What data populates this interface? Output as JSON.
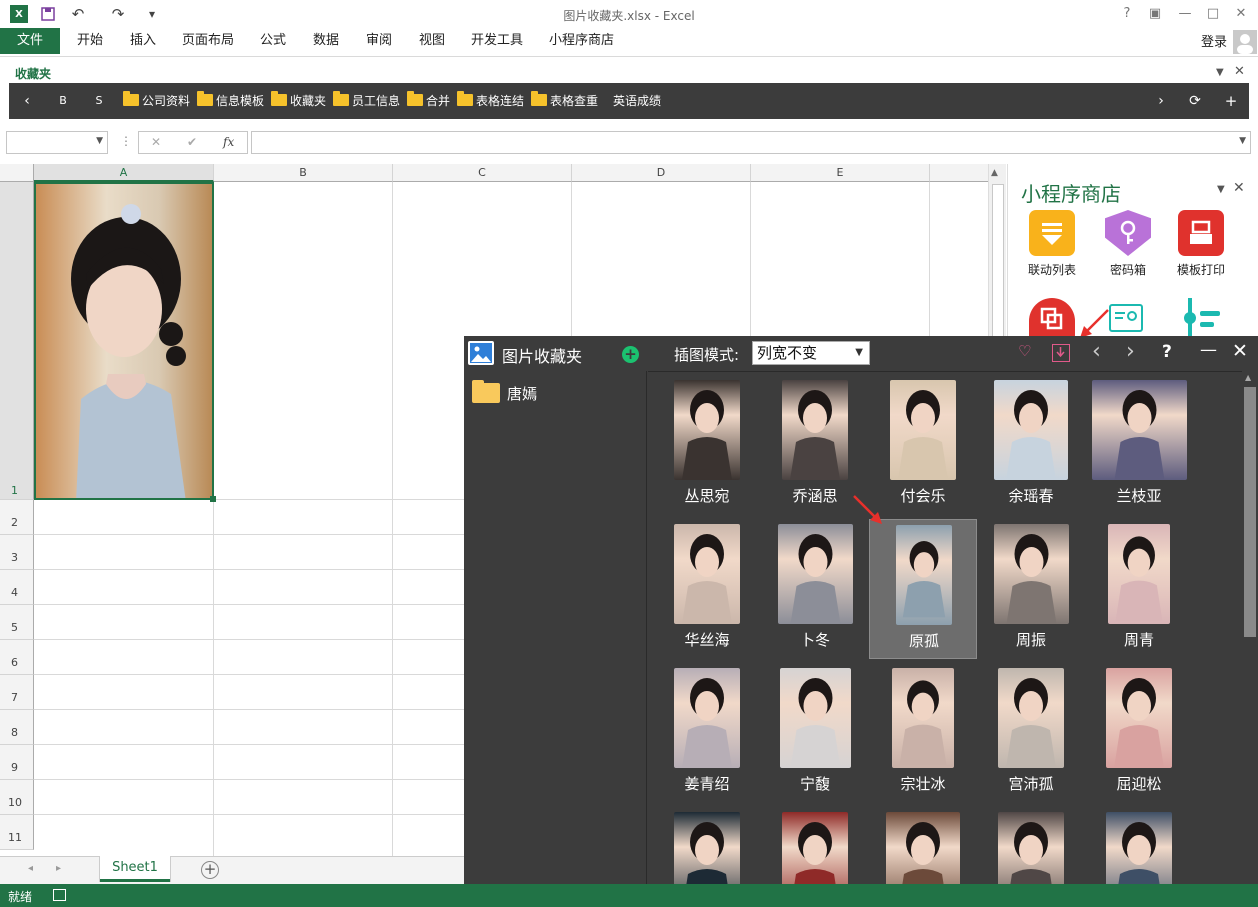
{
  "window": {
    "title": "图片收藏夹.xlsx - Excel"
  },
  "quick_access": {
    "undo": "↶",
    "redo": "↷",
    "customize": "▾"
  },
  "ribbon": {
    "file": "文件",
    "tabs": [
      "开始",
      "插入",
      "页面布局",
      "公式",
      "数据",
      "审阅",
      "视图",
      "开发工具",
      "小程序商店"
    ],
    "login": "登录"
  },
  "favorites": {
    "title": "收藏夹",
    "bold": "B",
    "strike": "S",
    "items": [
      "公司资料",
      "信息模板",
      "收藏夹",
      "员工信息",
      "合并",
      "表格连结",
      "表格查重"
    ],
    "last": "英语成绩"
  },
  "formula_bar": {
    "fx": "fx",
    "name_box": "",
    "formula": ""
  },
  "grid": {
    "columns": [
      "A",
      "B",
      "C",
      "D",
      "E"
    ],
    "rows": [
      "1",
      "2",
      "3",
      "4",
      "5",
      "6",
      "7",
      "8",
      "9",
      "10",
      "11"
    ]
  },
  "sheets": {
    "active": "Sheet1",
    "add": "+"
  },
  "status": {
    "ready": "就绪"
  },
  "store": {
    "title": "小程序商店",
    "apps": [
      {
        "label": "联动列表",
        "color": "#f9b21b"
      },
      {
        "label": "密码箱",
        "color": "#b972d8"
      },
      {
        "label": "模板打印",
        "color": "#e0322d"
      },
      {
        "label": "",
        "color": "#e0322d"
      },
      {
        "label": "",
        "color": "#1bb9b0"
      },
      {
        "label": "",
        "color": "#1bb9b0"
      }
    ]
  },
  "panel": {
    "title": "图片收藏夹",
    "mode_label": "插图模式:",
    "mode_value": "列宽不变",
    "folder": "唐嫣",
    "selected": "原孤",
    "thumbs": [
      {
        "name": "丛思宛",
        "color": "#3a3330"
      },
      {
        "name": "乔涵思",
        "color": "#4a4241"
      },
      {
        "name": "付会乐",
        "color": "#d8c6ae"
      },
      {
        "name": "余瑶春",
        "color": "#c7d3de"
      },
      {
        "name": "兰枝亚",
        "color": "#5d5c7e"
      },
      {
        "name": "华丝海",
        "color": "#cbb7ab"
      },
      {
        "name": "卜冬",
        "color": "#8c8e98"
      },
      {
        "name": "原孤",
        "color": "#8da0ae"
      },
      {
        "name": "周振",
        "color": "#7e7571"
      },
      {
        "name": "周青",
        "color": "#d9b5b7"
      },
      {
        "name": "姜青绍",
        "color": "#b7aeb6"
      },
      {
        "name": "宁馥",
        "color": "#d6d3d3"
      },
      {
        "name": "宗壮冰",
        "color": "#c9b1a8"
      },
      {
        "name": "宫沛孤",
        "color": "#bfb6ae"
      },
      {
        "name": "屈迎松",
        "color": "#d9a2a0"
      },
      {
        "name": "",
        "color": "#1d2a35"
      },
      {
        "name": "",
        "color": "#8f2a28"
      },
      {
        "name": "",
        "color": "#6c4a3a"
      },
      {
        "name": "",
        "color": "#504746"
      },
      {
        "name": "",
        "color": "#3e4f66"
      }
    ]
  },
  "colors": {
    "excel_green": "#217346",
    "dark_panel": "#3c3c3c",
    "arrow_red": "#e8302b"
  }
}
